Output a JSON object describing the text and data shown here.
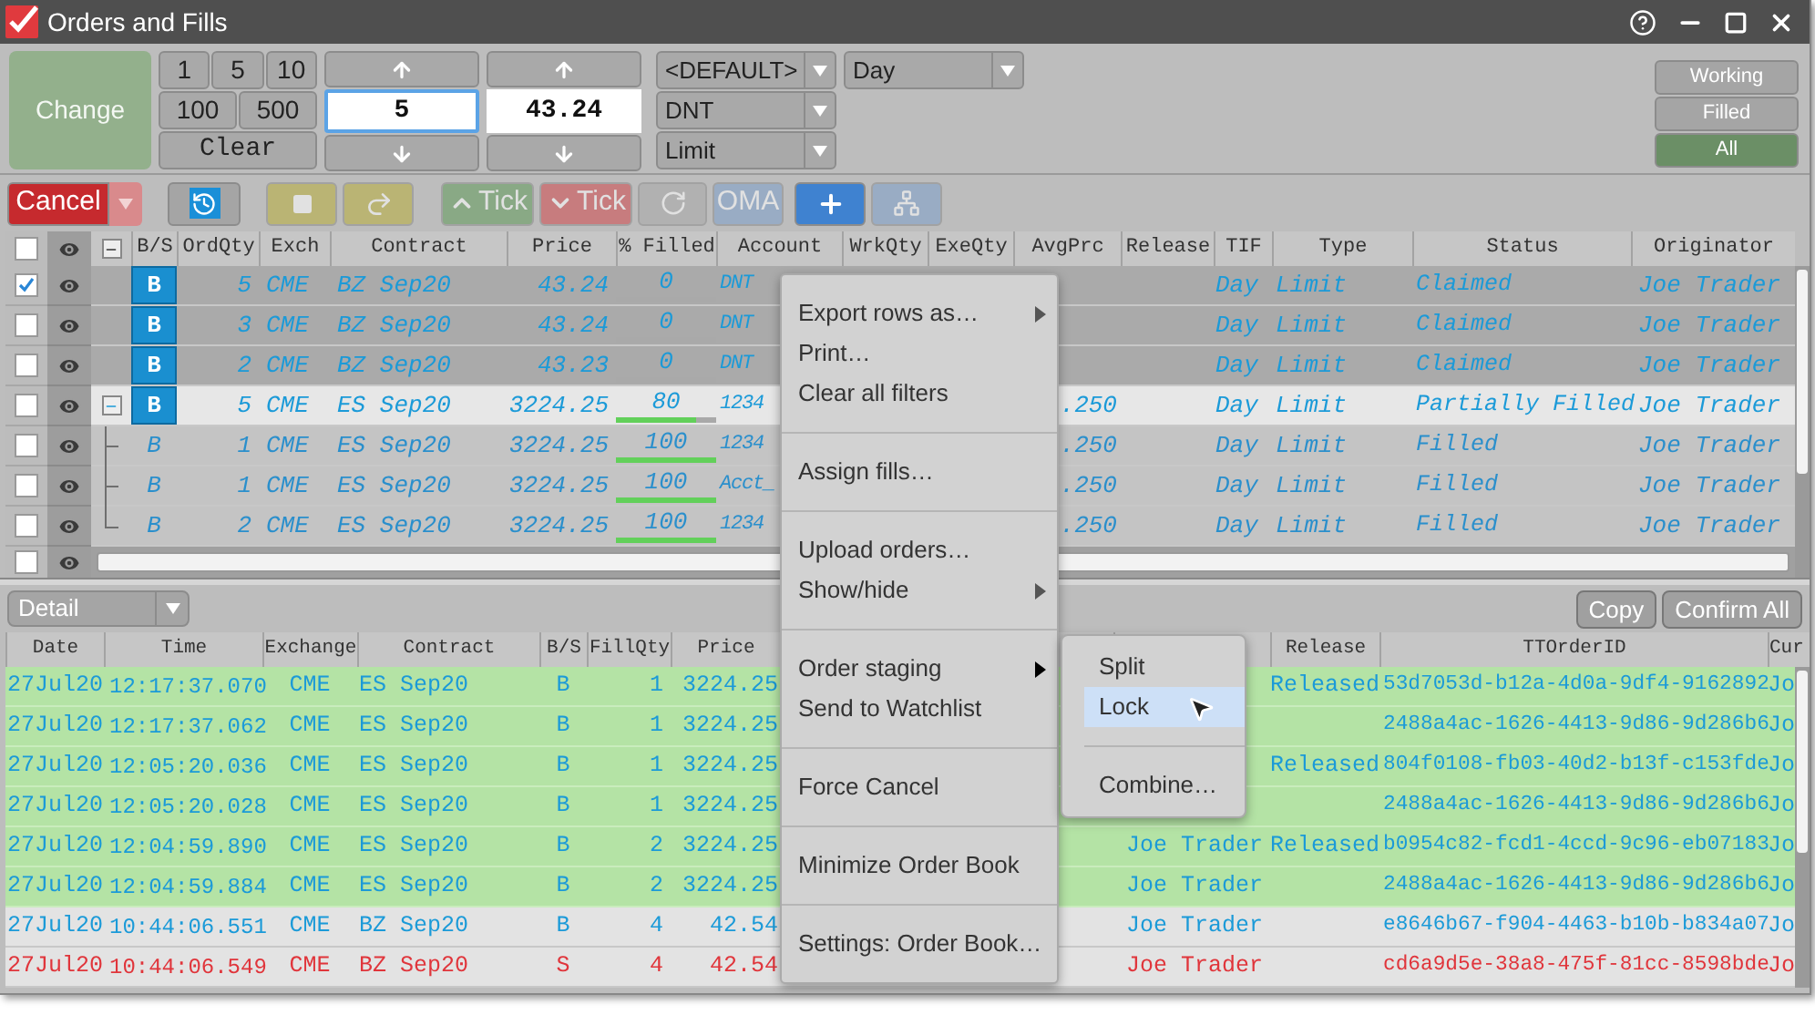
{
  "window": {
    "title": "Orders and Fills"
  },
  "order_entry": {
    "change_button": {
      "label": "Change",
      "disabled": true
    },
    "qty_buttons": [
      "1",
      "5",
      "10",
      "100",
      "500"
    ],
    "clear_button": "Clear",
    "quantity": "5",
    "price": "43.24",
    "profile": "<DEFAULT>",
    "account": "DNT",
    "order_type": "Limit",
    "tif": "Day"
  },
  "filters": [
    {
      "label": "Working",
      "selected": false
    },
    {
      "label": "Filled",
      "selected": false
    },
    {
      "label": "All",
      "selected": true
    }
  ],
  "actions": [
    {
      "kind": "cancel",
      "label": "Cancel",
      "disabled": false
    },
    {
      "kind": "history",
      "disabled": false
    },
    {
      "kind": "stop",
      "disabled": true
    },
    {
      "kind": "redo",
      "disabled": true
    },
    {
      "kind": "tick_up",
      "label": "Tick",
      "disabled": true
    },
    {
      "kind": "tick_down",
      "label": "Tick",
      "disabled": true
    },
    {
      "kind": "refresh",
      "disabled": true
    },
    {
      "kind": "oma",
      "label": "OMA",
      "disabled": true
    },
    {
      "kind": "add",
      "disabled": false
    },
    {
      "kind": "network",
      "disabled": true
    }
  ],
  "order_table": {
    "header_checked": false,
    "columns": [
      "B/S",
      "OrdQty",
      "Exch",
      "Contract",
      "Price",
      "% Filled",
      "Account",
      "WrkQty",
      "ExeQty",
      "AvgPrc",
      "Release",
      "TIF",
      "Type",
      "Status",
      "Originator"
    ],
    "rows": [
      {
        "checked": true,
        "selected": false,
        "bs": "B",
        "ord_qty": "5",
        "exch": "CME",
        "contract": "BZ Sep20",
        "price": "43.24",
        "pct_filled": "0",
        "level": 0,
        "account": "DNT",
        "tif": "Day",
        "type": "Limit",
        "status": "Claimed",
        "originator": "Joe Trader"
      },
      {
        "checked": false,
        "selected": false,
        "bs": "B",
        "ord_qty": "3",
        "exch": "CME",
        "contract": "BZ Sep20",
        "price": "43.24",
        "pct_filled": "0",
        "level": 0,
        "account": "DNT",
        "tif": "Day",
        "type": "Limit",
        "status": "Claimed",
        "originator": "Joe Trader"
      },
      {
        "checked": false,
        "selected": false,
        "bs": "B",
        "ord_qty": "2",
        "exch": "CME",
        "contract": "BZ Sep20",
        "price": "43.23",
        "pct_filled": "0",
        "level": 0,
        "account": "DNT",
        "tif": "Day",
        "type": "Limit",
        "status": "Claimed",
        "originator": "Joe Trader"
      },
      {
        "checked": false,
        "selected": true,
        "expanded": true,
        "bs": "B",
        "ord_qty": "5",
        "exch": "CME",
        "contract": "ES Sep20",
        "price": "3224.25",
        "pct_filled": "80",
        "level": 0.8,
        "account": "1234",
        "avg_prc": ".250",
        "tif": "Day",
        "type": "Limit",
        "status": "Partially Filled",
        "originator": "Joe Trader",
        "children": [
          {
            "checked": false,
            "selected": false,
            "bs": "B",
            "ord_qty": "1",
            "exch": "CME",
            "contract": "ES Sep20",
            "price": "3224.25",
            "pct_filled": "100",
            "level": 1,
            "account": "1234",
            "avg_prc": ".250",
            "tif": "Day",
            "type": "Limit",
            "status": "Filled",
            "originator": "Joe Trader"
          },
          {
            "checked": false,
            "selected": false,
            "bs": "B",
            "ord_qty": "1",
            "exch": "CME",
            "contract": "ES Sep20",
            "price": "3224.25",
            "pct_filled": "100",
            "level": 1,
            "account": "Acct_",
            "avg_prc": ".250",
            "tif": "Day",
            "type": "Limit",
            "status": "Filled",
            "originator": "Joe Trader"
          },
          {
            "checked": false,
            "selected": false,
            "bs": "B",
            "ord_qty": "2",
            "exch": "CME",
            "contract": "ES Sep20",
            "price": "3224.25",
            "pct_filled": "100",
            "level": 1,
            "account": "1234",
            "avg_prc": ".250",
            "tif": "Day",
            "type": "Limit",
            "status": "Filled",
            "originator": "Joe Trader"
          }
        ]
      }
    ],
    "partial_row": {
      "checked": false
    }
  },
  "fills_panel": {
    "view_dropdown": "Detail",
    "buttons": [
      "Copy",
      "Confirm All"
    ],
    "columns": [
      "Date",
      "Time",
      "Exchange",
      "Contract",
      "B/S",
      "FillQty",
      "Price",
      "Release",
      "TTOrderID",
      "Cur"
    ],
    "rows": [
      {
        "kind": "buy",
        "highlighted": true,
        "date": "27Jul20",
        "time": "12:17:37.070",
        "exchange": "CME",
        "contract": "ES Sep20",
        "bs": "B",
        "fill_qty": "1",
        "price": "3224.25",
        "release": "Released",
        "tt_order_id": "53d7053d-b12a-4d0a-9df4-9162892",
        "column_cur": "Jo"
      },
      {
        "kind": "buy",
        "highlighted": true,
        "date": "27Jul20",
        "time": "12:17:37.062",
        "exchange": "CME",
        "contract": "ES Sep20",
        "bs": "B",
        "fill_qty": "1",
        "price": "3224.25",
        "tt_order_id": "2488a4ac-1626-4413-9d86-9d286b6",
        "column_cur": "Jo"
      },
      {
        "kind": "buy",
        "highlighted": true,
        "date": "27Jul20",
        "time": "12:05:20.036",
        "exchange": "CME",
        "contract": "ES Sep20",
        "bs": "B",
        "fill_qty": "1",
        "price": "3224.25",
        "release": "Released",
        "tt_order_id": "804f0108-fb03-40d2-b13f-c153fde",
        "column_cur": "Jo"
      },
      {
        "kind": "buy",
        "highlighted": true,
        "date": "27Jul20",
        "time": "12:05:20.028",
        "exchange": "CME",
        "contract": "ES Sep20",
        "bs": "B",
        "fill_qty": "1",
        "price": "3224.25",
        "tt_order_id": "2488a4ac-1626-4413-9d86-9d286b6",
        "column_cur": "Jo"
      },
      {
        "kind": "buy",
        "highlighted": true,
        "date": "27Jul20",
        "time": "12:04:59.890",
        "exchange": "CME",
        "contract": "ES Sep20",
        "bs": "B",
        "fill_qty": "2",
        "price": "3224.25",
        "originator": "Joe Trader",
        "release": "Released",
        "tt_order_id": "b0954c82-fcd1-4ccd-9c96-eb07183",
        "column_cur": "Jo"
      },
      {
        "kind": "buy",
        "highlighted": true,
        "date": "27Jul20",
        "time": "12:04:59.884",
        "exchange": "CME",
        "contract": "ES Sep20",
        "bs": "B",
        "fill_qty": "2",
        "price": "3224.25",
        "originator": "Joe Trader",
        "tt_order_id": "2488a4ac-1626-4413-9d86-9d286b6",
        "column_cur": "Jo"
      },
      {
        "kind": "buy",
        "highlighted": false,
        "date": "27Jul20",
        "time": "10:44:06.551",
        "exchange": "CME",
        "contract": "BZ Sep20",
        "bs": "B",
        "fill_qty": "4",
        "price": "42.54",
        "originator": "Joe Trader",
        "tt_order_id": "e8646b67-f904-4463-b10b-b834a07",
        "column_cur": "Jo"
      },
      {
        "kind": "sell",
        "highlighted": false,
        "date": "27Jul20",
        "time": "10:44:06.549",
        "exchange": "CME",
        "contract": "BZ Sep20",
        "bs": "S",
        "fill_qty": "4",
        "price": "42.54",
        "originator": "Joe Trader",
        "tt_order_id": "cd6a9d5e-38a8-475f-81cc-8598bde",
        "column_cur": "Jo"
      }
    ]
  },
  "context_menu": {
    "groups": [
      [
        {
          "kind": "submenu",
          "label": "Export rows as…",
          "expanded": false
        },
        {
          "kind": "action",
          "label": "Print…"
        },
        {
          "kind": "action",
          "label": "Clear all filters"
        }
      ],
      [
        {
          "kind": "action",
          "label": "Assign fills…"
        }
      ],
      [
        {
          "kind": "action",
          "label": "Upload orders…"
        },
        {
          "kind": "submenu",
          "label": "Show/hide",
          "expanded": false
        }
      ],
      [
        {
          "kind": "submenu",
          "label": "Order staging",
          "expanded": true,
          "submenu": [
            [
              {
                "label": "Split",
                "selected": false
              },
              {
                "label": "Lock",
                "selected": true
              }
            ],
            [
              {
                "label": "Combine…",
                "selected": false
              }
            ]
          ]
        },
        {
          "kind": "action",
          "label": "Send to Watchlist"
        }
      ],
      [
        {
          "kind": "action",
          "label": "Force Cancel"
        }
      ],
      [
        {
          "kind": "action",
          "label": "Minimize Order Book"
        }
      ],
      [
        {
          "kind": "action",
          "label": "Settings: Order Book…"
        }
      ]
    ]
  }
}
